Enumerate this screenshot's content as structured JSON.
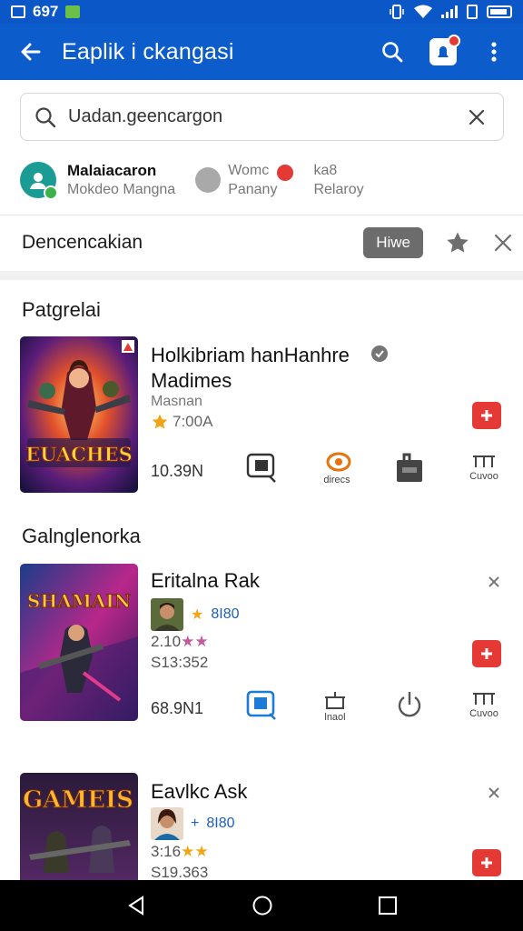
{
  "status_bar": {
    "time": "697"
  },
  "app_bar": {
    "title": "Eaplik i ckangasi"
  },
  "search": {
    "placeholder": "Uadan.geencargon"
  },
  "accounts": [
    {
      "main": "Malaiacaron",
      "sub": "Mokdeo Mangna"
    },
    {
      "main": "Womc",
      "sub": "Panany"
    },
    {
      "main": "ka8",
      "sub": "Relaroy"
    }
  ],
  "filter": {
    "label": "Dencencakian",
    "chip": "Hiwe"
  },
  "sections": [
    {
      "title": "Patgrelai",
      "games": [
        {
          "title_line1": "Holkibriam hanHanhre",
          "title_line2": "Madimes",
          "developer": "Masnan",
          "rating_text": "7:00A",
          "size": "10.39N",
          "cover_text": "EUACHES",
          "tools": [
            {
              "icon": "screen-icon",
              "label": ""
            },
            {
              "icon": "direct-icon",
              "label": "direcs"
            },
            {
              "icon": "box-icon",
              "label": ""
            },
            {
              "icon": "cuvo-icon",
              "label": "Cuvoo"
            }
          ]
        }
      ]
    },
    {
      "title": "Galnglenorka",
      "games": [
        {
          "title_line1": "Eritalna Rak",
          "tag": "8I80",
          "rating_text": "2.10",
          "price": "S13:352",
          "size": "68.9N1",
          "cover_text": "SHAMAIN",
          "tools": [
            {
              "icon": "screen-icon",
              "label": ""
            },
            {
              "icon": "bucket-icon",
              "label": "lnaol"
            },
            {
              "icon": "power-icon",
              "label": ""
            },
            {
              "icon": "cuvo-icon",
              "label": "Cuvoo"
            }
          ]
        },
        {
          "title_line1": "Eavlkc Ask",
          "tag": "8I80",
          "rating_text": "3:16",
          "price": "S19.363",
          "cover_text": "GAMEIS"
        }
      ]
    }
  ],
  "colors": {
    "primary": "#0d5ccc",
    "accent_red": "#e53935",
    "star": "#f2a416"
  }
}
